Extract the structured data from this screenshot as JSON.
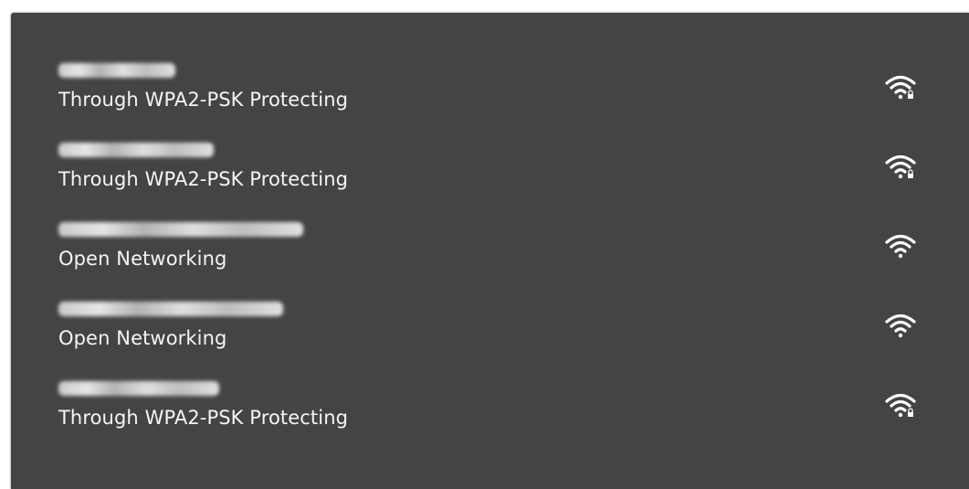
{
  "networks": [
    {
      "security": "Through WPA2-PSK Protecting",
      "secured": true,
      "signal_icon": "wifi-lock-icon"
    },
    {
      "security": "Through WPA2-PSK Protecting",
      "secured": true,
      "signal_icon": "wifi-lock-icon"
    },
    {
      "security": "Open Networking",
      "secured": false,
      "signal_icon": "wifi-icon"
    },
    {
      "security": "Open Networking",
      "secured": false,
      "signal_icon": "wifi-icon"
    },
    {
      "security": "Through WPA2-PSK Protecting",
      "secured": true,
      "signal_icon": "wifi-lock-icon"
    }
  ],
  "colors": {
    "panel": "#444444",
    "text": "#f5f5f5",
    "icon": "#ffffff"
  }
}
